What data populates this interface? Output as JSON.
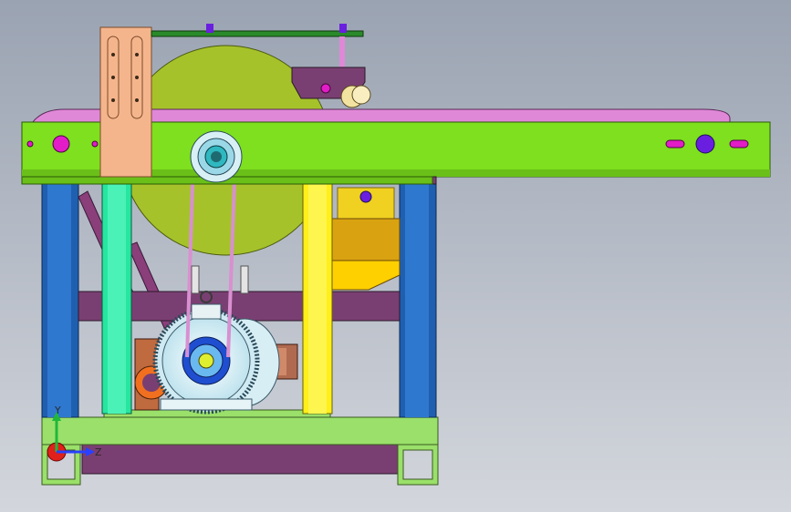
{
  "viewport": {
    "background_top": "#9aa3b2",
    "background_bottom": "#d3d6dc"
  },
  "triad": {
    "y_label": "Y",
    "z_label": "Z",
    "y_color": "#1fb83a",
    "z_color": "#2940ff",
    "x_color": "#e0201a"
  },
  "colors": {
    "frame_green": "#7ee01f",
    "base_green": "#9ae06a",
    "leg_blue": "#1f5fb0",
    "strut_teal": "#27e6a0",
    "strut_yellow": "#ffef1a",
    "blade_olive": "#a6c22a",
    "copper_plate": "#f5b58c",
    "crossbar_purple": "#7a3f72",
    "belt_pink": "#d890d0",
    "motor_fins": "#cfeaf2",
    "pulley_blue": "#1f4fd0",
    "terminal_box": "#b06a50",
    "hopper_gold": "#d9a210",
    "bolt_magenta": "#e21cc7",
    "bolt_violet": "#6a1fe0"
  }
}
